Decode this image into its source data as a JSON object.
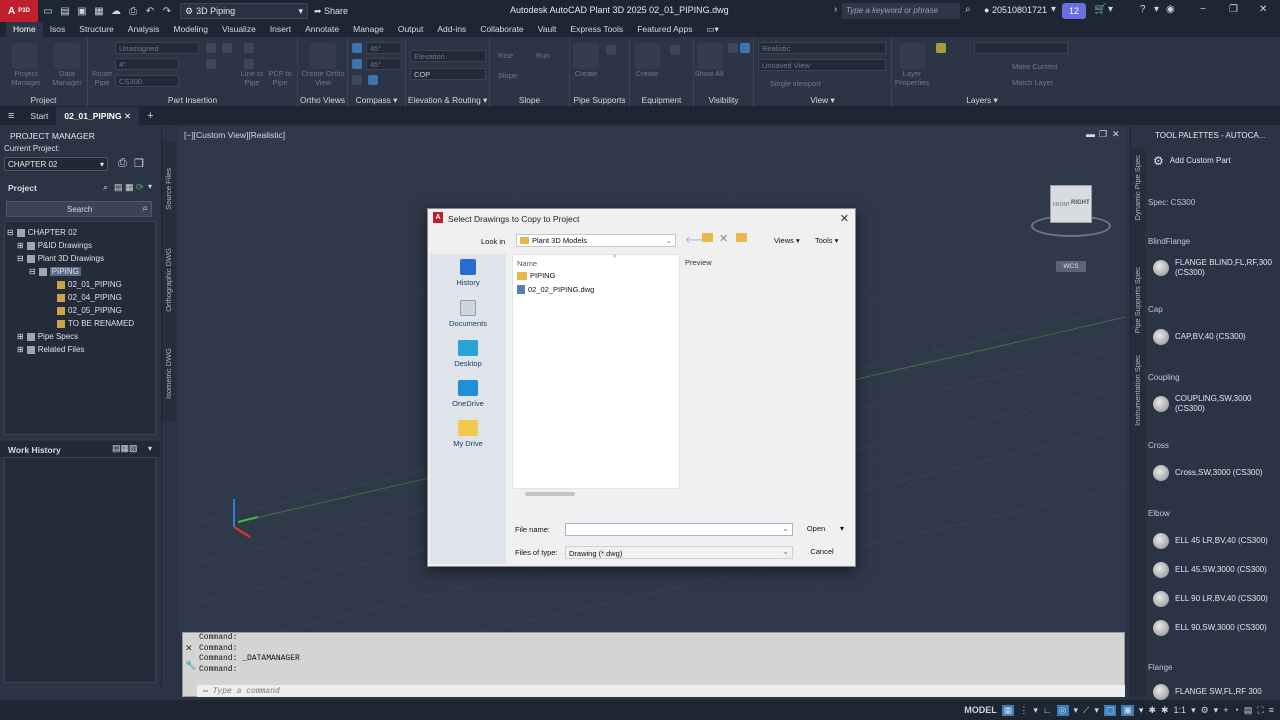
{
  "app": {
    "badge": "P3D",
    "title": "Autodesk AutoCAD Plant 3D 2025   02_01_PIPING.dwg",
    "workspace": "3D Piping",
    "share": "Share",
    "search_placeholder": "Type a keyword or phrase",
    "user": "20510801721",
    "notifications": "12"
  },
  "menu": [
    "Home",
    "Isos",
    "Structure",
    "Analysis",
    "Modeling",
    "Visualize",
    "Insert",
    "Annotate",
    "Manage",
    "Output",
    "Add-ins",
    "Collaborate",
    "Vault",
    "Express Tools",
    "Featured Apps"
  ],
  "ribbon": {
    "panels": [
      "Project",
      "Part Insertion",
      "Ortho Views",
      "Compass",
      "Elevation & Routing",
      "Slope",
      "Pipe Supports",
      "Equipment",
      "Visibility",
      "View",
      "Layers"
    ],
    "project_btns": [
      "Project Manager",
      "Data Manager"
    ],
    "part_insertion_btns": [
      "Route Pipe",
      "Line to Pipe",
      "PCF to Pipe"
    ],
    "ortho_btns": [
      "Create Ortho View"
    ],
    "slope_fields": [
      "Rise",
      "Run",
      "Slope"
    ],
    "line_selects": [
      "Unassigned",
      "4\"",
      "CS300"
    ],
    "compass_angles": [
      "45°",
      "45°"
    ],
    "elevation_fields": [
      "Elevation",
      "COP"
    ],
    "visual_style": "Realistic",
    "view_select": "Unsaved View",
    "view_btn": "Single viewport",
    "layer_btns": [
      "Make Current",
      "Match Layer"
    ],
    "support_btns": [
      "Create"
    ],
    "equipment_btns": [
      "Create"
    ],
    "visibility_btns": [
      "Show All"
    ],
    "layer_props": "Layer Properties"
  },
  "doc_tabs": [
    "Start",
    "02_01_PIPING"
  ],
  "project_manager": {
    "title": "PROJECT MANAGER",
    "current_project_label": "Current Project:",
    "current_project": "CHAPTER 02",
    "section": "Project",
    "search_label": "Search",
    "tree": [
      {
        "label": "CHAPTER 02",
        "level": 0
      },
      {
        "label": "P&ID Drawings",
        "level": 1
      },
      {
        "label": "Plant 3D Drawings",
        "level": 1
      },
      {
        "label": "PIPING",
        "level": 2
      },
      {
        "label": "02_01_PIPING",
        "level": 3
      },
      {
        "label": "02_04_PIPING",
        "level": 3
      },
      {
        "label": "02_05_PIPING",
        "level": 3
      },
      {
        "label": "TO BE RENAMED",
        "level": 3
      },
      {
        "label": "Pipe Specs",
        "level": 1
      },
      {
        "label": "Related Files",
        "level": 1
      }
    ],
    "work_history": "Work History"
  },
  "vertical_tabs": [
    "Source Files",
    "Orthographic DWG",
    "Isometric DWG"
  ],
  "viewport": {
    "label": "[−][Custom View][Realistic]",
    "viewcube_face": "RIGHT",
    "viewcube_top": "FRONT",
    "wcs": "WCS"
  },
  "command": {
    "lines": [
      "Command:",
      "Command:",
      "Command: _DATAMANAGER",
      "Command:"
    ],
    "placeholder": "Type a command"
  },
  "tool_palettes": {
    "title": "TOOL PALETTES - AUTOCA...",
    "side_tabs": [
      "Dynamic Pipe Spec",
      "Pipe Supports Spec",
      "Instrumentation Spec"
    ],
    "add_custom": "Add Custom Part",
    "spec": "Spec: CS300",
    "sections": [
      {
        "name": "BlindFlange",
        "items": [
          "FLANGE BLIND,FL,RF,300 (CS300)"
        ]
      },
      {
        "name": "Cap",
        "items": [
          "CAP,BV,40 (CS300)"
        ]
      },
      {
        "name": "Coupling",
        "items": [
          "COUPLING,SW,3000 (CS300)"
        ]
      },
      {
        "name": "Cross",
        "items": [
          "Cross,SW,3000 (CS300)"
        ]
      },
      {
        "name": "Elbow",
        "items": [
          "ELL 45 LR,BV,40 (CS300)",
          "ELL 45,SW,3000 (CS300)",
          "ELL 90 LR,BV,40 (CS300)",
          "ELL 90,SW,3000 (CS300)"
        ]
      },
      {
        "name": "Flange",
        "items": [
          "FLANGE SW,FL,RF 300"
        ]
      }
    ]
  },
  "status": {
    "model": "MODEL",
    "scale": "1:1"
  },
  "dialog": {
    "title": "Select Drawings to Copy to Project",
    "look_in_label": "Look in",
    "look_in": "Plant 3D Models",
    "views": "Views",
    "tools": "Tools",
    "places": [
      "History",
      "Documents",
      "Desktop",
      "OneDrive",
      "My Drive"
    ],
    "column_name": "Name",
    "files": [
      {
        "name": "PIPING",
        "type": "folder"
      },
      {
        "name": "02_02_PIPING.dwg",
        "type": "dwg"
      }
    ],
    "preview_label": "Preview",
    "file_name_label": "File name:",
    "file_name_value": "",
    "files_of_type_label": "Files of type:",
    "files_of_type": "Drawing (*.dwg)",
    "open": "Open",
    "cancel": "Cancel"
  }
}
